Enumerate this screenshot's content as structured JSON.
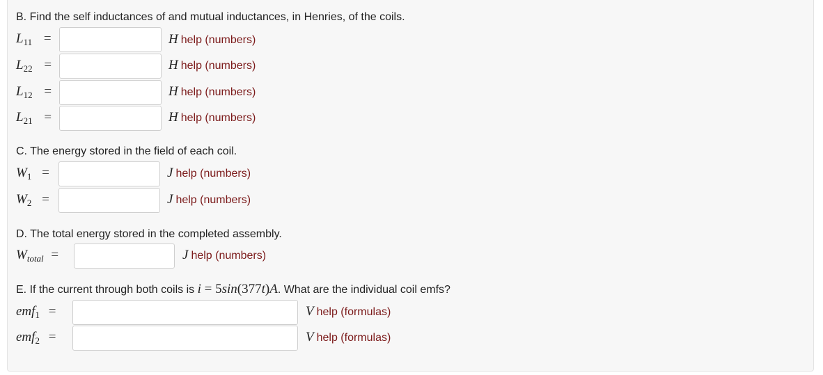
{
  "sectionB": {
    "heading": "B. Find the self inductances of and mutual inductances, in Henries, of the coils.",
    "rows": [
      {
        "var": "L",
        "sub": "11",
        "eq": "=",
        "unit": "H",
        "help": "help (numbers)",
        "value": ""
      },
      {
        "var": "L",
        "sub": "22",
        "eq": "=",
        "unit": "H",
        "help": "help (numbers)",
        "value": ""
      },
      {
        "var": "L",
        "sub": "12",
        "eq": "=",
        "unit": "H",
        "help": "help (numbers)",
        "value": ""
      },
      {
        "var": "L",
        "sub": "21",
        "eq": "=",
        "unit": "H",
        "help": "help (numbers)",
        "value": ""
      }
    ]
  },
  "sectionC": {
    "heading": "C. The energy stored in the field of each coil.",
    "rows": [
      {
        "var": "W",
        "sub": "1",
        "eq": "=",
        "unit": "J",
        "help": "help (numbers)",
        "value": ""
      },
      {
        "var": "W",
        "sub": "2",
        "eq": "=",
        "unit": "J",
        "help": "help (numbers)",
        "value": ""
      }
    ]
  },
  "sectionD": {
    "heading": "D. The total energy stored in the completed assembly.",
    "row": {
      "var": "W",
      "sub": "total",
      "eq": "=",
      "unit": "J",
      "help": "help (numbers)",
      "value": ""
    }
  },
  "sectionE": {
    "heading_prefix": "E. If the current through both coils is ",
    "heading_math_var": "i",
    "heading_math_eq": " = ",
    "heading_math_expr_num": "5",
    "heading_math_expr_fn": "sin",
    "heading_math_expr_arg_open": "(377",
    "heading_math_expr_arg_var": "t",
    "heading_math_expr_arg_close": ")",
    "heading_math_unit": "A",
    "heading_suffix": ". What are the individual coil emfs?",
    "rows": [
      {
        "var": "emf",
        "sub": "1",
        "eq": "=",
        "unit": "V",
        "help": "help (formulas)",
        "value": ""
      },
      {
        "var": "emf",
        "sub": "2",
        "eq": "=",
        "unit": "V",
        "help": "help (formulas)",
        "value": ""
      }
    ]
  }
}
